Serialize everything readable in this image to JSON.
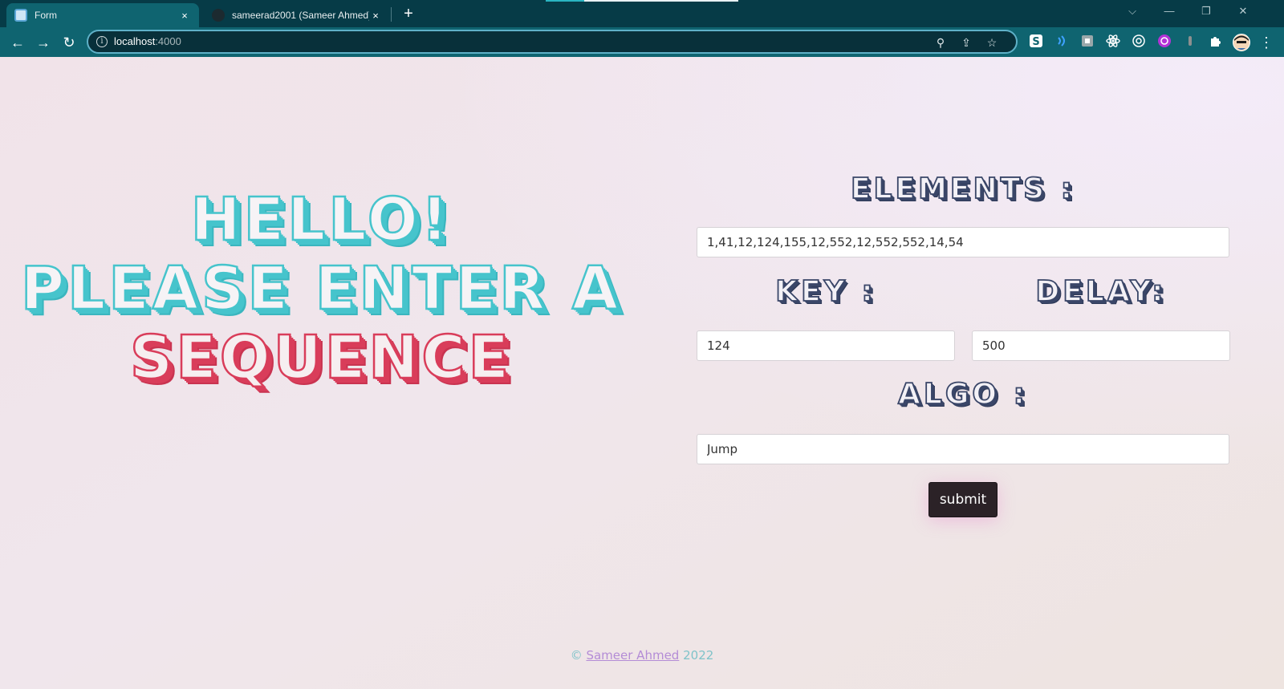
{
  "browser": {
    "tabs": [
      {
        "title": "Form",
        "close": "×"
      },
      {
        "title": "sameerad2001 (Sameer Ahmed)",
        "close": "×"
      }
    ],
    "new_tab": "+",
    "url_host": "localhost",
    "url_port": ":4000",
    "window_controls": {
      "tab_search": "⌵",
      "minimize": "—",
      "restore": "❐",
      "close": "✕"
    },
    "nav": {
      "back": "←",
      "forward": "→",
      "reload": "↻"
    },
    "icons": {
      "info": "i",
      "zoom": "⚲",
      "share": "⇪",
      "bookmark": "☆",
      "menu": "⋮"
    }
  },
  "hero": {
    "line1": "HELLO!",
    "line2": "PLEASE ENTER A",
    "line3": "SEQUENCE"
  },
  "form": {
    "elements_label": "ELEMENTS :",
    "elements_value": "1,41,12,124,155,12,552,12,552,552,14,54",
    "key_label": "KEY :",
    "key_value": "124",
    "delay_label": "DELAY:",
    "delay_value": "500",
    "algo_label": "ALGO :",
    "algo_value": "Jump",
    "submit_label": "submit"
  },
  "footer": {
    "copyright": "©",
    "author": "Sameer Ahmed",
    "year": "2022"
  },
  "colors": {
    "hero_teal": "#46c4cc",
    "hero_red": "#d93d5a",
    "label_navy": "#3a4668",
    "chrome_dark": "#063b47",
    "chrome_toolbar": "#0f6470"
  }
}
